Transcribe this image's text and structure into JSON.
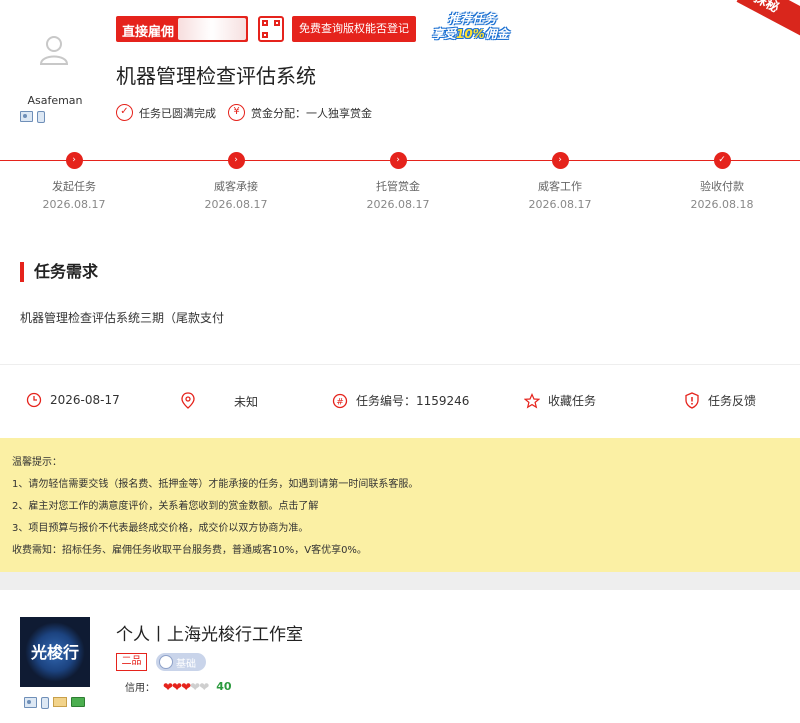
{
  "header": {
    "employer_name": "Asafeman",
    "tag_direct": "直接雇佣",
    "btn_query": "免费查询版权能否登记",
    "promo_line1": "推荐任务",
    "promo_line2_pre": "享受",
    "promo_line2_highlight": "10%",
    "promo_line2_post": "佣金",
    "corner_ribbon": "抹秘",
    "title": "机器管理检查评估系统",
    "status": "任务已圆满完成",
    "reward": "赏金分配：一人独享赏金",
    "status_icon": "check-circle-icon",
    "reward_icon": "yen-circle-icon"
  },
  "progress": {
    "steps": [
      {
        "label": "发起任务",
        "date": "2026.08.17"
      },
      {
        "label": "威客承接",
        "date": "2026.08.17"
      },
      {
        "label": "托管赏金",
        "date": "2026.08.17"
      },
      {
        "label": "威客工作",
        "date": "2026.08.17"
      },
      {
        "label": "验收付款",
        "date": "2026.08.18"
      }
    ]
  },
  "requirement": {
    "title": "任务需求",
    "text": "机器管理检查评估系统三期（尾款支付"
  },
  "info": {
    "date": "2026-08-17",
    "location": "未知",
    "task_no": "任务编号：1159246",
    "favorite": "收藏任务",
    "feedback": "任务反馈"
  },
  "tips": {
    "heading": "温馨提示：",
    "line1": "1、请勿轻信需要交钱（报名费、抵押金等）才能承接的任务，如遇到请第一时间联系客服。",
    "line2": "2、雇主对您工作的满意度评价，关系着您收到的赏金数额。点击了解",
    "line3": "3、项目预算与报价不代表最终成交价格，成交价以双方协商为准。",
    "line4": "收费需知：招标任务、雇佣任务收取平台服务费，普通威客10%，V客优享0%。"
  },
  "provider": {
    "logo_text": "光梭行",
    "name": "个人丨上海光梭行工作室",
    "rank": "二品",
    "level": "基础",
    "credit_label": "信用：",
    "hearts_on": "❤❤❤",
    "hearts_off": "❤❤",
    "score": "40"
  },
  "colors": {
    "accent": "#e5231c",
    "tips_bg": "#fbf0a4",
    "score": "#2b9a3e"
  }
}
